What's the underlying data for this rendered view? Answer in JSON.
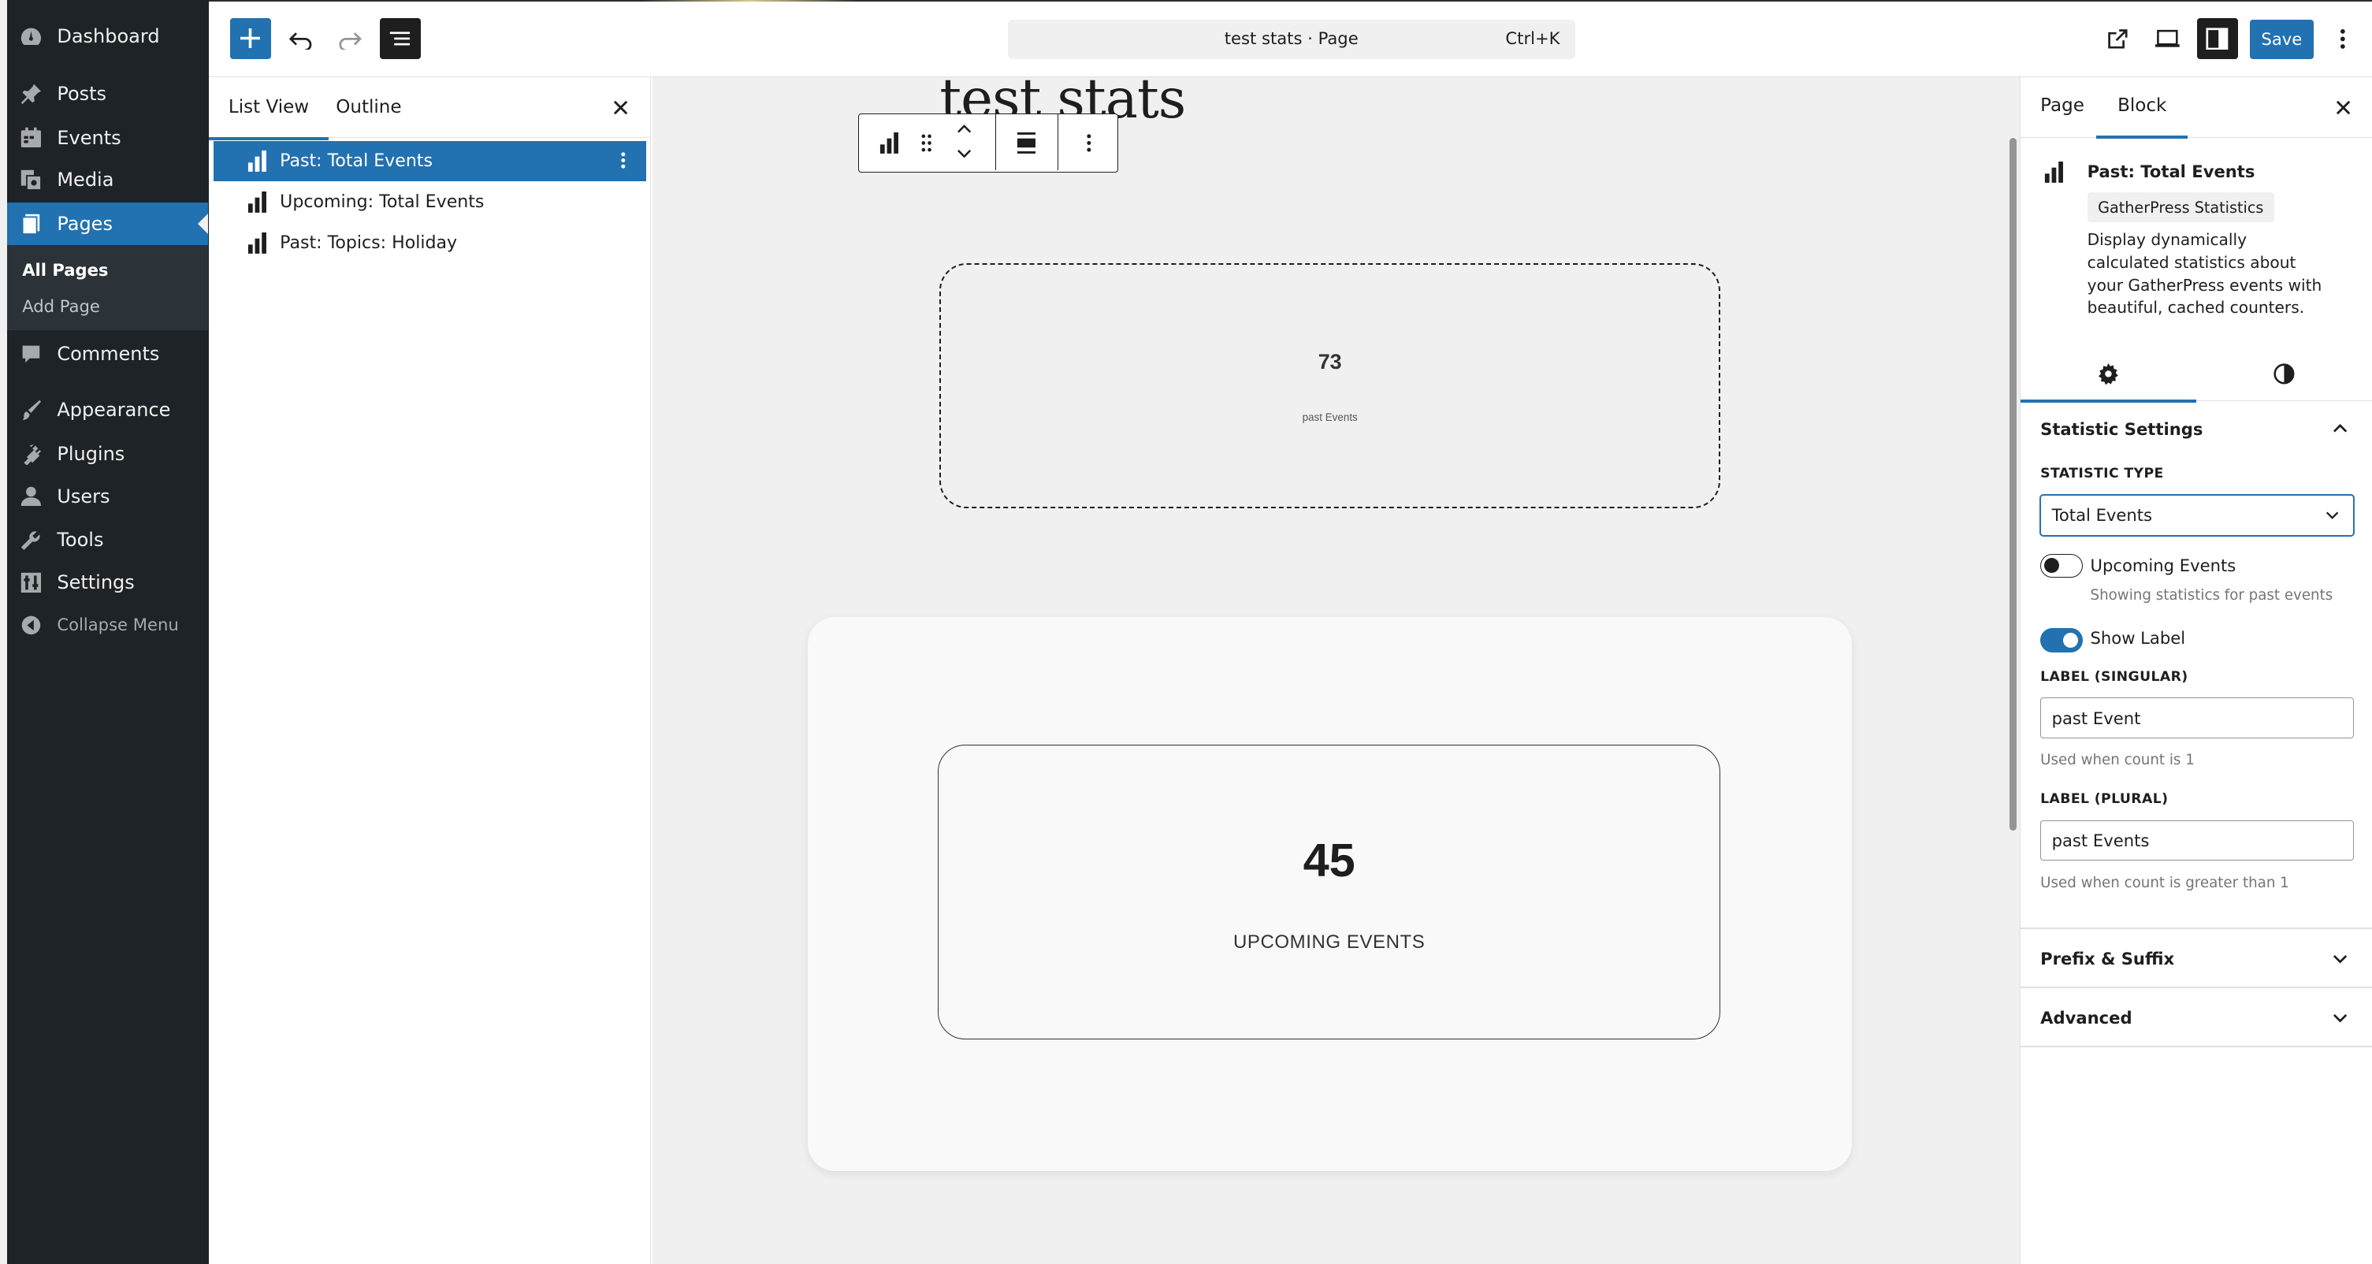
{
  "admin_menu": {
    "items": [
      {
        "label": "Dashboard",
        "icon": "dashboard-icon"
      },
      {
        "label": "Posts",
        "icon": "pushpin-icon"
      },
      {
        "label": "Events",
        "icon": "calendar-icon"
      },
      {
        "label": "Media",
        "icon": "media-icon"
      },
      {
        "label": "Pages",
        "icon": "pages-icon"
      },
      {
        "label": "Comments",
        "icon": "comment-icon"
      },
      {
        "label": "Appearance",
        "icon": "paintbrush-icon"
      },
      {
        "label": "Plugins",
        "icon": "plugin-icon"
      },
      {
        "label": "Users",
        "icon": "user-icon"
      },
      {
        "label": "Tools",
        "icon": "wrench-icon"
      },
      {
        "label": "Settings",
        "icon": "settings-icon"
      }
    ],
    "submenu": [
      "All Pages",
      "Add Page"
    ],
    "collapse_label": "Collapse Menu"
  },
  "toolbar": {
    "document_title": "test stats · Page",
    "shortcut": "Ctrl+K",
    "save_label": "Save"
  },
  "list_view": {
    "tabs": [
      "List View",
      "Outline"
    ],
    "items": [
      "Past: Total Events",
      "Upcoming: Total Events",
      "Past: Topics: Holiday"
    ]
  },
  "canvas": {
    "page_title": "test stats",
    "stat_past": {
      "number": "73",
      "label": "past Events"
    },
    "stat_upcoming": {
      "number": "45",
      "label": "UPCOMING EVENTS"
    }
  },
  "settings": {
    "tabs": [
      "Page",
      "Block"
    ],
    "block_title": "Past: Total Events",
    "block_badge": "GatherPress Statistics",
    "block_description": "Display dynamically calculated statistics about your GatherPress events with beautiful, cached counters.",
    "panel_statistic": "Statistic Settings",
    "statistic_type_label": "STATISTIC TYPE",
    "statistic_type_value": "Total Events",
    "upcoming_toggle_label": "Upcoming Events",
    "upcoming_toggle_help": "Showing statistics for past events",
    "show_label_toggle": "Show Label",
    "label_singular": "LABEL (SINGULAR)",
    "label_singular_value": "past Event",
    "label_singular_help": "Used when count is 1",
    "label_plural": "LABEL (PLURAL)",
    "label_plural_value": "past Events",
    "label_plural_help": "Used when count is greater than 1",
    "panel_prefix": "Prefix & Suffix",
    "panel_advanced": "Advanced"
  },
  "colors": {
    "accent": "#2271b1",
    "admin_bg": "#1d2327",
    "canvas_bg": "#f0f0f0"
  }
}
